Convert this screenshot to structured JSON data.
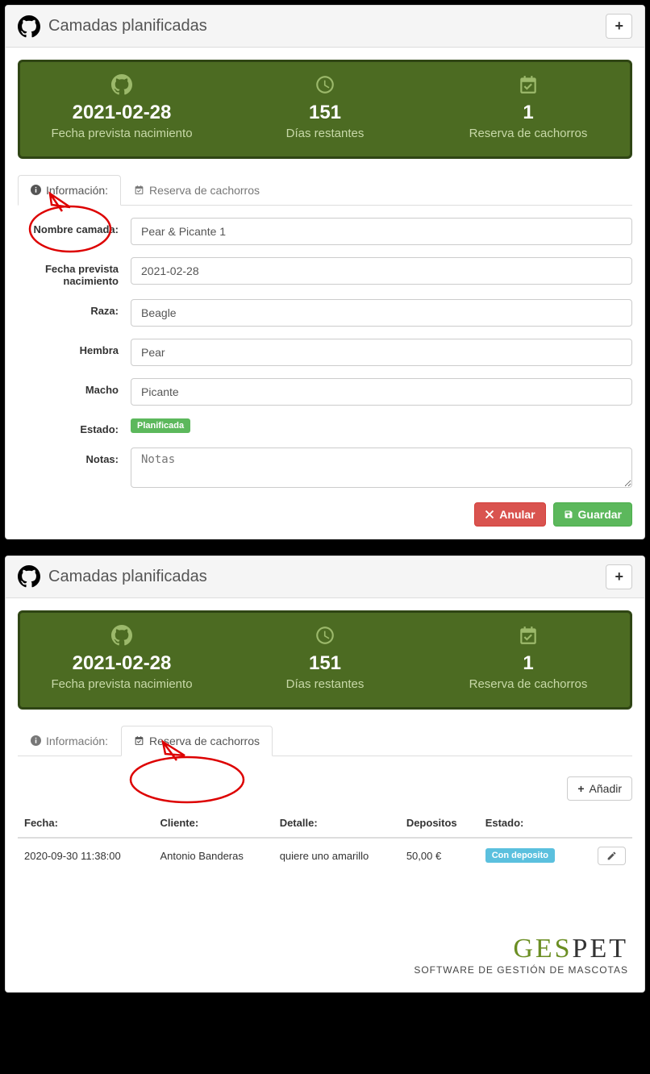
{
  "panel1": {
    "title": "Camadas planificadas",
    "jumbo": {
      "date": "2021-02-28",
      "date_lbl": "Fecha prevista nacimiento",
      "days": "151",
      "days_lbl": "Días restantes",
      "res": "1",
      "res_lbl": "Reserva de cachorros"
    },
    "tabs": {
      "info": "Información:",
      "res": "Reserva de cachorros"
    },
    "form": {
      "name_lbl": "Nombre camada:",
      "name_val": "Pear & Picante 1",
      "date_lbl": "Fecha prevista nacimiento",
      "date_val": "2021-02-28",
      "breed_lbl": "Raza:",
      "breed_val": "Beagle",
      "female_lbl": "Hembra",
      "female_val": "Pear",
      "male_lbl": "Macho",
      "male_val": "Picante",
      "state_lbl": "Estado:",
      "state_val": "Planificada",
      "notes_lbl": "Notas:",
      "notes_ph": "Notas"
    },
    "actions": {
      "cancel": "Anular",
      "save": "Guardar"
    }
  },
  "panel2": {
    "title": "Camadas planificadas",
    "jumbo": {
      "date": "2021-02-28",
      "date_lbl": "Fecha prevista nacimiento",
      "days": "151",
      "days_lbl": "Días restantes",
      "res": "1",
      "res_lbl": "Reserva de cachorros"
    },
    "tabs": {
      "info": "Información:",
      "res": "Reserva de cachorros"
    },
    "add": "Añadir",
    "table": {
      "h_date": "Fecha:",
      "h_client": "Cliente:",
      "h_detail": "Detalle:",
      "h_dep": "Depositos",
      "h_state": "Estado:",
      "r1": {
        "date": "2020-09-30 11:38:00",
        "client": "Antonio Banderas",
        "detail": "quiere uno amarillo",
        "dep": "50,00 €",
        "state": "Con deposito"
      }
    }
  },
  "brand": {
    "name": "GESPET",
    "sub": "SOFTWARE DE GESTIÓN DE MASCOTAS"
  }
}
